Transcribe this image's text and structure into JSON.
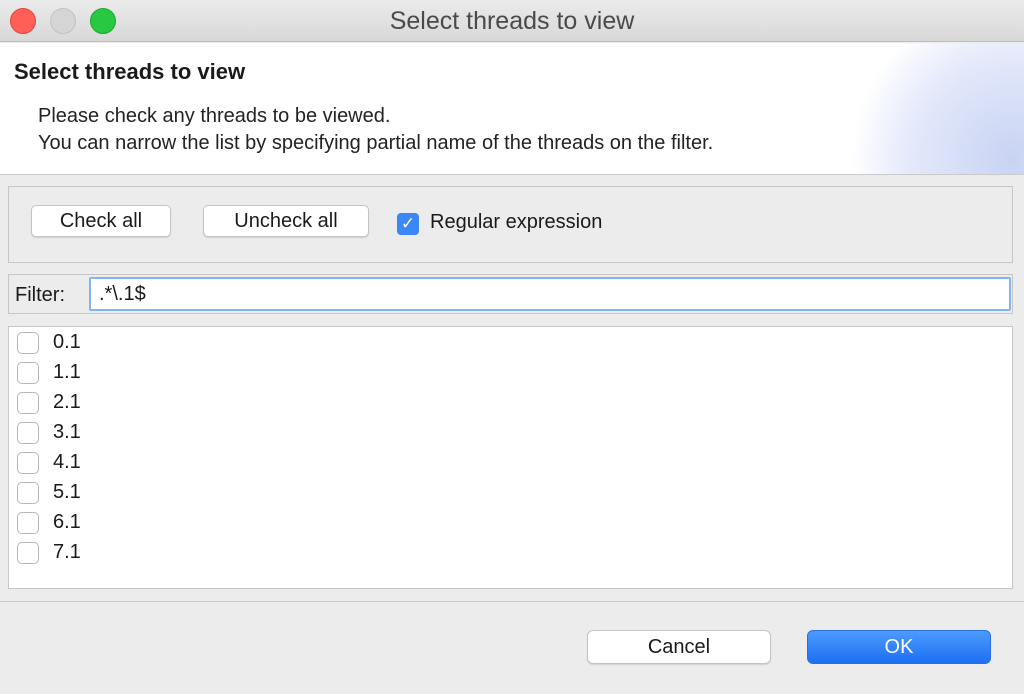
{
  "window": {
    "title": "Select threads to view"
  },
  "header": {
    "title": "Select threads to view",
    "description_line1": "Please check any threads to be viewed.",
    "description_line2": "You can narrow the list by specifying partial name of the threads on the filter."
  },
  "actions": {
    "check_all_label": "Check all",
    "uncheck_all_label": "Uncheck all",
    "regex_label": "Regular expression",
    "regex_checked": true
  },
  "filter": {
    "label": "Filter:",
    "value": ".*\\.1$"
  },
  "threads": [
    {
      "label": "0.1",
      "checked": false
    },
    {
      "label": "1.1",
      "checked": false
    },
    {
      "label": "2.1",
      "checked": false
    },
    {
      "label": "3.1",
      "checked": false
    },
    {
      "label": "4.1",
      "checked": false
    },
    {
      "label": "5.1",
      "checked": false
    },
    {
      "label": "6.1",
      "checked": false
    },
    {
      "label": "7.1",
      "checked": false
    }
  ],
  "footer": {
    "cancel_label": "Cancel",
    "ok_label": "OK"
  },
  "colors": {
    "accent": "#3b87f4",
    "ok_button": "#1e6ff3",
    "close_light": "#ff5f57",
    "maximize_light": "#28c840"
  }
}
